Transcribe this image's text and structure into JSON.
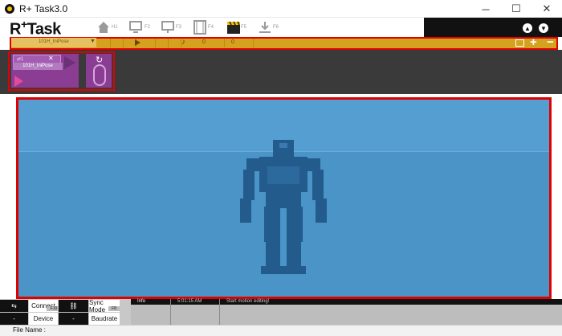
{
  "window": {
    "title": "R+ Task3.0",
    "controls": {
      "minimize": "─",
      "maximize": "☐",
      "close": "✕"
    }
  },
  "header": {
    "logo": {
      "prefix": "R",
      "plus": "+",
      "suffix": "Task"
    },
    "nav": [
      {
        "icon": "home-icon",
        "label": "H1"
      },
      {
        "icon": "monitor-icon",
        "label": "F2"
      },
      {
        "icon": "display-icon",
        "label": "F3"
      },
      {
        "icon": "film-icon",
        "label": "F4"
      },
      {
        "icon": "clapperboard-icon",
        "label": "F5"
      },
      {
        "icon": "download-icon",
        "label": "F6"
      }
    ],
    "right_icons": [
      "upload-circle-icon",
      "download-circle-icon"
    ]
  },
  "timeline": {
    "pose_name": "101H_IniPose",
    "frame_value": "0",
    "time_value": "0",
    "plus_label": "+",
    "minus_label": "−"
  },
  "motion_panel": {
    "bar_label": "⇄1",
    "close_label": "✕",
    "motion_name": "101H_IniPose",
    "loop_icon": "↻"
  },
  "statusbar": {
    "connect_label": "Connect",
    "connect_hint": "F10",
    "connect_value": "-",
    "device_label": "Device",
    "device_value": "-",
    "sync_mode_label": "Sync Mode",
    "sync_mode_hint": "F8",
    "baudrate_label": "Baudrate",
    "info_header": "Info",
    "time": "5:01:15 AM",
    "message": "Start motion editing!"
  },
  "file": {
    "label": "File Name :"
  },
  "colors": {
    "timeline_bg": "#d4a21e",
    "highlight_border": "#e00000",
    "motion_card": "#8a3d93",
    "viewport": "#4a94c7",
    "robot": "#225b8c"
  }
}
